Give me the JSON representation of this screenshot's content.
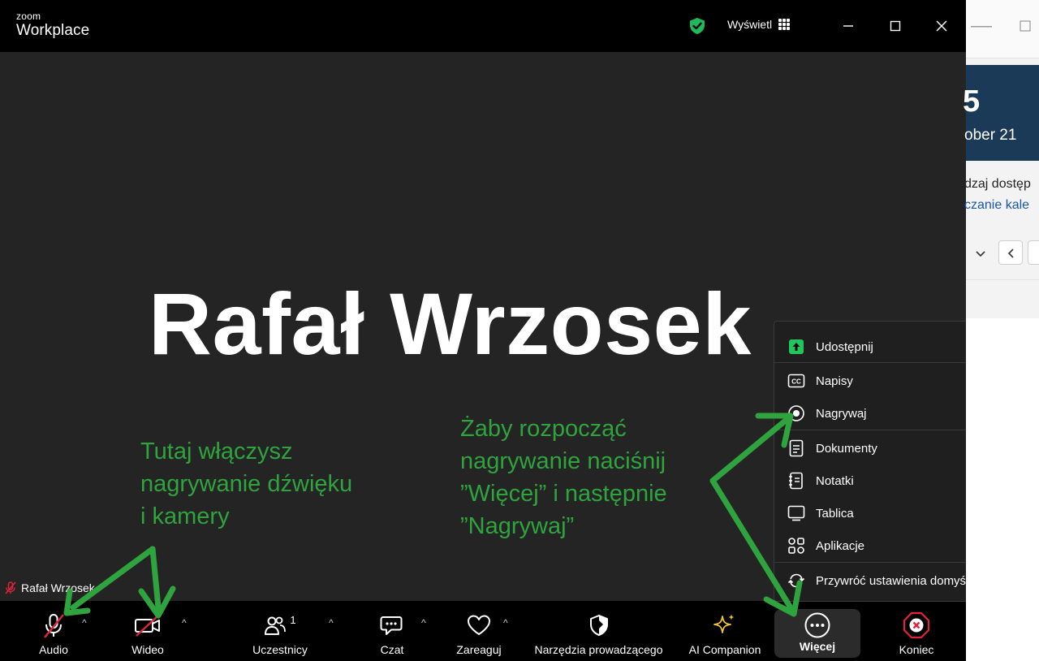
{
  "window": {
    "logo_small": "zoom",
    "logo_big": "Workplace",
    "view_label": "Wyświetl"
  },
  "video": {
    "display_name": "Rafał Wrzosek",
    "participant_label": "Rafał Wrzosek"
  },
  "annotations": {
    "left": "Tutaj włączysz\nnagrywanie dźwięku\ni kamery",
    "right": "Żaby rozpocząć\nnagrywanie naciśnij\n”Więcej” i następnie\n”Nagrywaj”"
  },
  "toolbar": {
    "audio": "Audio",
    "video": "Wideo",
    "participants": "Uczestnicy",
    "participants_count": "1",
    "chat": "Czat",
    "react": "Zareaguj",
    "host_tools": "Narzędzia prowadzącego",
    "ai_companion": "AI Companion",
    "more": "Więcej",
    "end": "Koniec"
  },
  "more_menu": {
    "items": [
      {
        "label": "Udostępnij",
        "icon": "share-icon",
        "has_submenu": true
      },
      {
        "label": "Napisy",
        "icon": "captions-icon",
        "has_submenu": false
      },
      {
        "label": "Nagrywaj",
        "icon": "record-icon",
        "has_submenu": true
      },
      {
        "label": "Dokumenty",
        "icon": "document-icon",
        "has_submenu": true
      },
      {
        "label": "Notatki",
        "icon": "notes-icon",
        "has_submenu": true
      },
      {
        "label": "Tablica",
        "icon": "whiteboard-icon",
        "has_submenu": true
      },
      {
        "label": "Aplikacje",
        "icon": "apps-icon",
        "has_submenu": true
      },
      {
        "label": "Przywróć ustawienia domyślne",
        "icon": "reset-icon",
        "has_submenu": false
      }
    ]
  },
  "background_browser": {
    "big_number": "5",
    "date": "ober 21",
    "text1": "dzaj dostęp",
    "text2": "czanie kale"
  },
  "colors": {
    "annotation": "#2fa43e",
    "shield": "#1fb85a",
    "share_icon": "#22c55e",
    "end_icon": "#e0243c",
    "ai_star": "#f1c232",
    "muted": "#e0243c"
  }
}
